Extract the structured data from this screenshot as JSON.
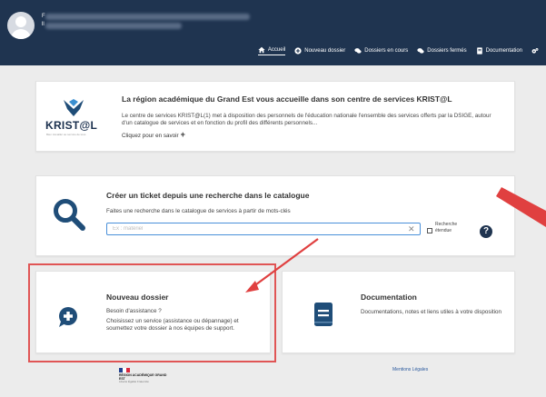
{
  "header": {
    "user_initial": "F",
    "user_sub": "ll",
    "nav": [
      {
        "label": "Accueil",
        "icon": "home-icon"
      },
      {
        "label": "Nouveau dossier",
        "icon": "plus-circle-icon"
      },
      {
        "label": "Dossiers en cours",
        "icon": "chat-icon"
      },
      {
        "label": "Dossiers fermés",
        "icon": "chat-icon"
      },
      {
        "label": "Documentation",
        "icon": "book-icon"
      },
      {
        "label": "",
        "icon": "gears-icon"
      }
    ]
  },
  "welcome": {
    "logo_text": "KRIST@L",
    "logo_tagline": "Bien travailler au service de tous",
    "title": "La région académique du Grand Est vous accueille dans son centre de services KRIST@L",
    "text": "Le centre de services KRIST@L(1) met à disposition des personnels de l'éducation nationale l'ensemble des services offerts par la DSIGE, autour d'un catalogue de services et en fonction du profil des différents personnels...",
    "more_label": "Cliquez pour en savoir"
  },
  "search": {
    "title": "Créer un ticket depuis une recherche dans le catalogue",
    "description": "Faites une recherche dans le catalogue de services à partir de mots-clés",
    "placeholder": "Ex : matériel",
    "extended_label": "Recherche étendue",
    "help_label": "?"
  },
  "new_ticket": {
    "title": "Nouveau dossier",
    "line1": "Besoin d'assistance ?",
    "text": "Choisissez un service (assistance ou dépannage) et soumettez votre dossier à nos équipes de support."
  },
  "documentation": {
    "title": "Documentation",
    "text": "Documentations, notes et liens utiles à votre disposition"
  },
  "footer": {
    "logo_line1": "RÉGION ACADÉMIQUE GRAND EST",
    "logo_line2": "Liberté Égalité Fraternité",
    "legal_label": "Mentions Légales"
  },
  "colors": {
    "header_bg": "#1f3450",
    "icon_blue": "#1f4d78",
    "highlight": "#e05555",
    "arrow": "#e04040"
  }
}
